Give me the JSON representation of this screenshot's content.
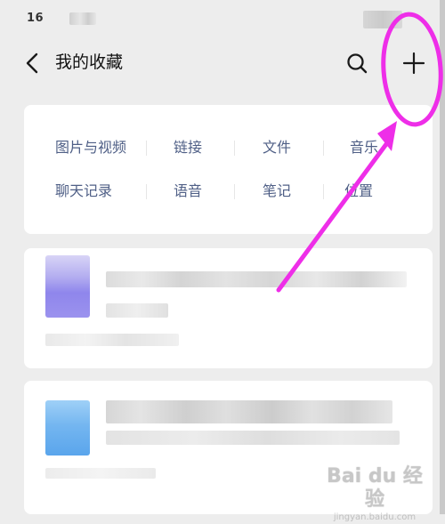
{
  "status_bar": {
    "time_visible": "16"
  },
  "header": {
    "title": "我的收藏",
    "icons": {
      "back": "chevron-left-icon",
      "search": "search-icon",
      "add": "plus-icon"
    }
  },
  "categories": {
    "row1": [
      "图片与视频",
      "链接",
      "文件",
      "音乐"
    ],
    "row2": [
      "聊天记录",
      "语音",
      "笔记",
      "位置"
    ]
  },
  "annotation": {
    "color": "#ee2ee8"
  },
  "watermark": {
    "logo": "Bai du 经验",
    "url": "jingyan.baidu.com"
  },
  "colors": {
    "background": "#ededed",
    "card": "#ffffff",
    "category_text": "#4f5f86",
    "title_text": "#111111"
  }
}
